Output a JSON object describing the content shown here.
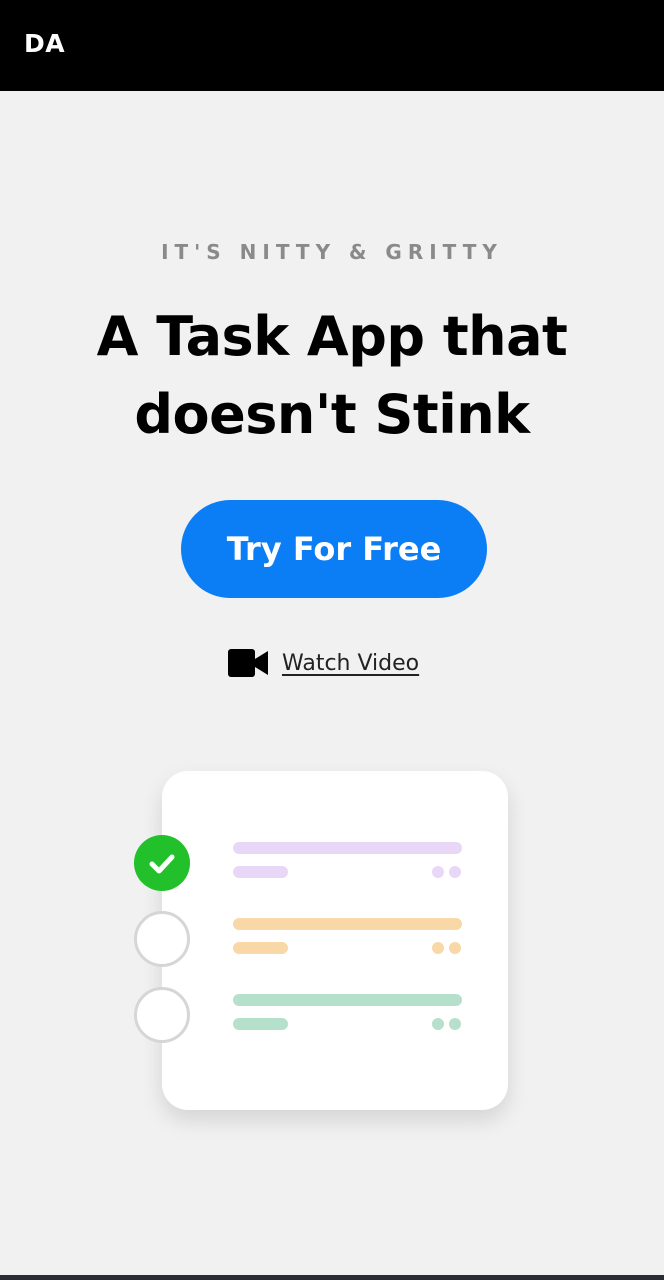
{
  "header": {
    "logo": "DA"
  },
  "hero": {
    "eyebrow": "IT'S NITTY & GRITTY",
    "headline_line1": "A Task App that",
    "headline_line2": "doesn't Stink",
    "cta_label": "Try For Free",
    "video_link_label": "Watch Video",
    "video_icon": "video-camera-icon"
  },
  "illustration": {
    "tasks": [
      {
        "done": true,
        "color": "#e9d7f7",
        "icon": "check-icon"
      },
      {
        "done": false,
        "color": "#f9d8a8",
        "icon": "empty-circle-icon"
      },
      {
        "done": false,
        "color": "#b5e0cc",
        "icon": "empty-circle-icon"
      }
    ]
  },
  "colors": {
    "accent": "#0b7ef5",
    "header_bg": "#000000",
    "page_bg": "#f1f1f1",
    "check_green": "#22c02a"
  }
}
